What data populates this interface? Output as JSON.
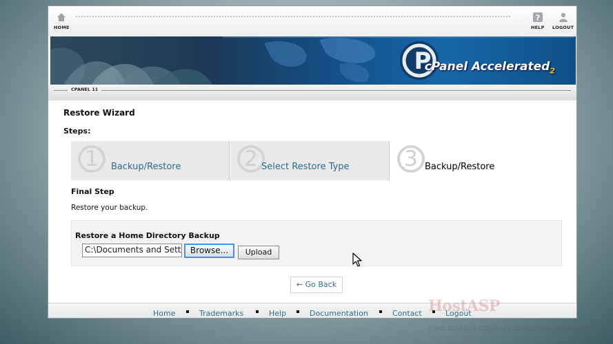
{
  "topbar": {
    "home_label": "HOME",
    "help_label": "HELP",
    "logout_label": "LOGOUT"
  },
  "banner": {
    "brand": "cPanel Accelerated",
    "brand_suffix": "2",
    "logo_letter": "P"
  },
  "version_label": "CPANEL 11",
  "page": {
    "title": "Restore Wizard",
    "steps_label": "Steps:",
    "steps": [
      {
        "number": "1",
        "label": "Backup/Restore",
        "state": "done"
      },
      {
        "number": "2",
        "label": "Select Restore Type",
        "state": "done"
      },
      {
        "number": "3",
        "label": "Backup/Restore",
        "state": "current"
      }
    ],
    "final_step_heading": "Final Step",
    "final_step_text": "Restore your backup."
  },
  "restore_form": {
    "heading": "Restore a Home Directory Backup",
    "file_value": "C:\\Documents and Setti",
    "browse_label": "Browse...",
    "upload_label": "Upload"
  },
  "go_back_label": "← Go Back",
  "footer": {
    "links": [
      "Home",
      "Trademarks",
      "Help",
      "Documentation",
      "Contact",
      "Logout"
    ]
  },
  "watermark": {
    "name": "HostASP",
    "tagline": "your trusted application service provider"
  },
  "colors": {
    "link": "#2e6c8c",
    "banner_blue": "#1767a8",
    "focus_blue": "#4b8fe0"
  },
  "icons": [
    "home-icon",
    "help-icon",
    "logout-icon",
    "mouse-cursor-icon"
  ]
}
